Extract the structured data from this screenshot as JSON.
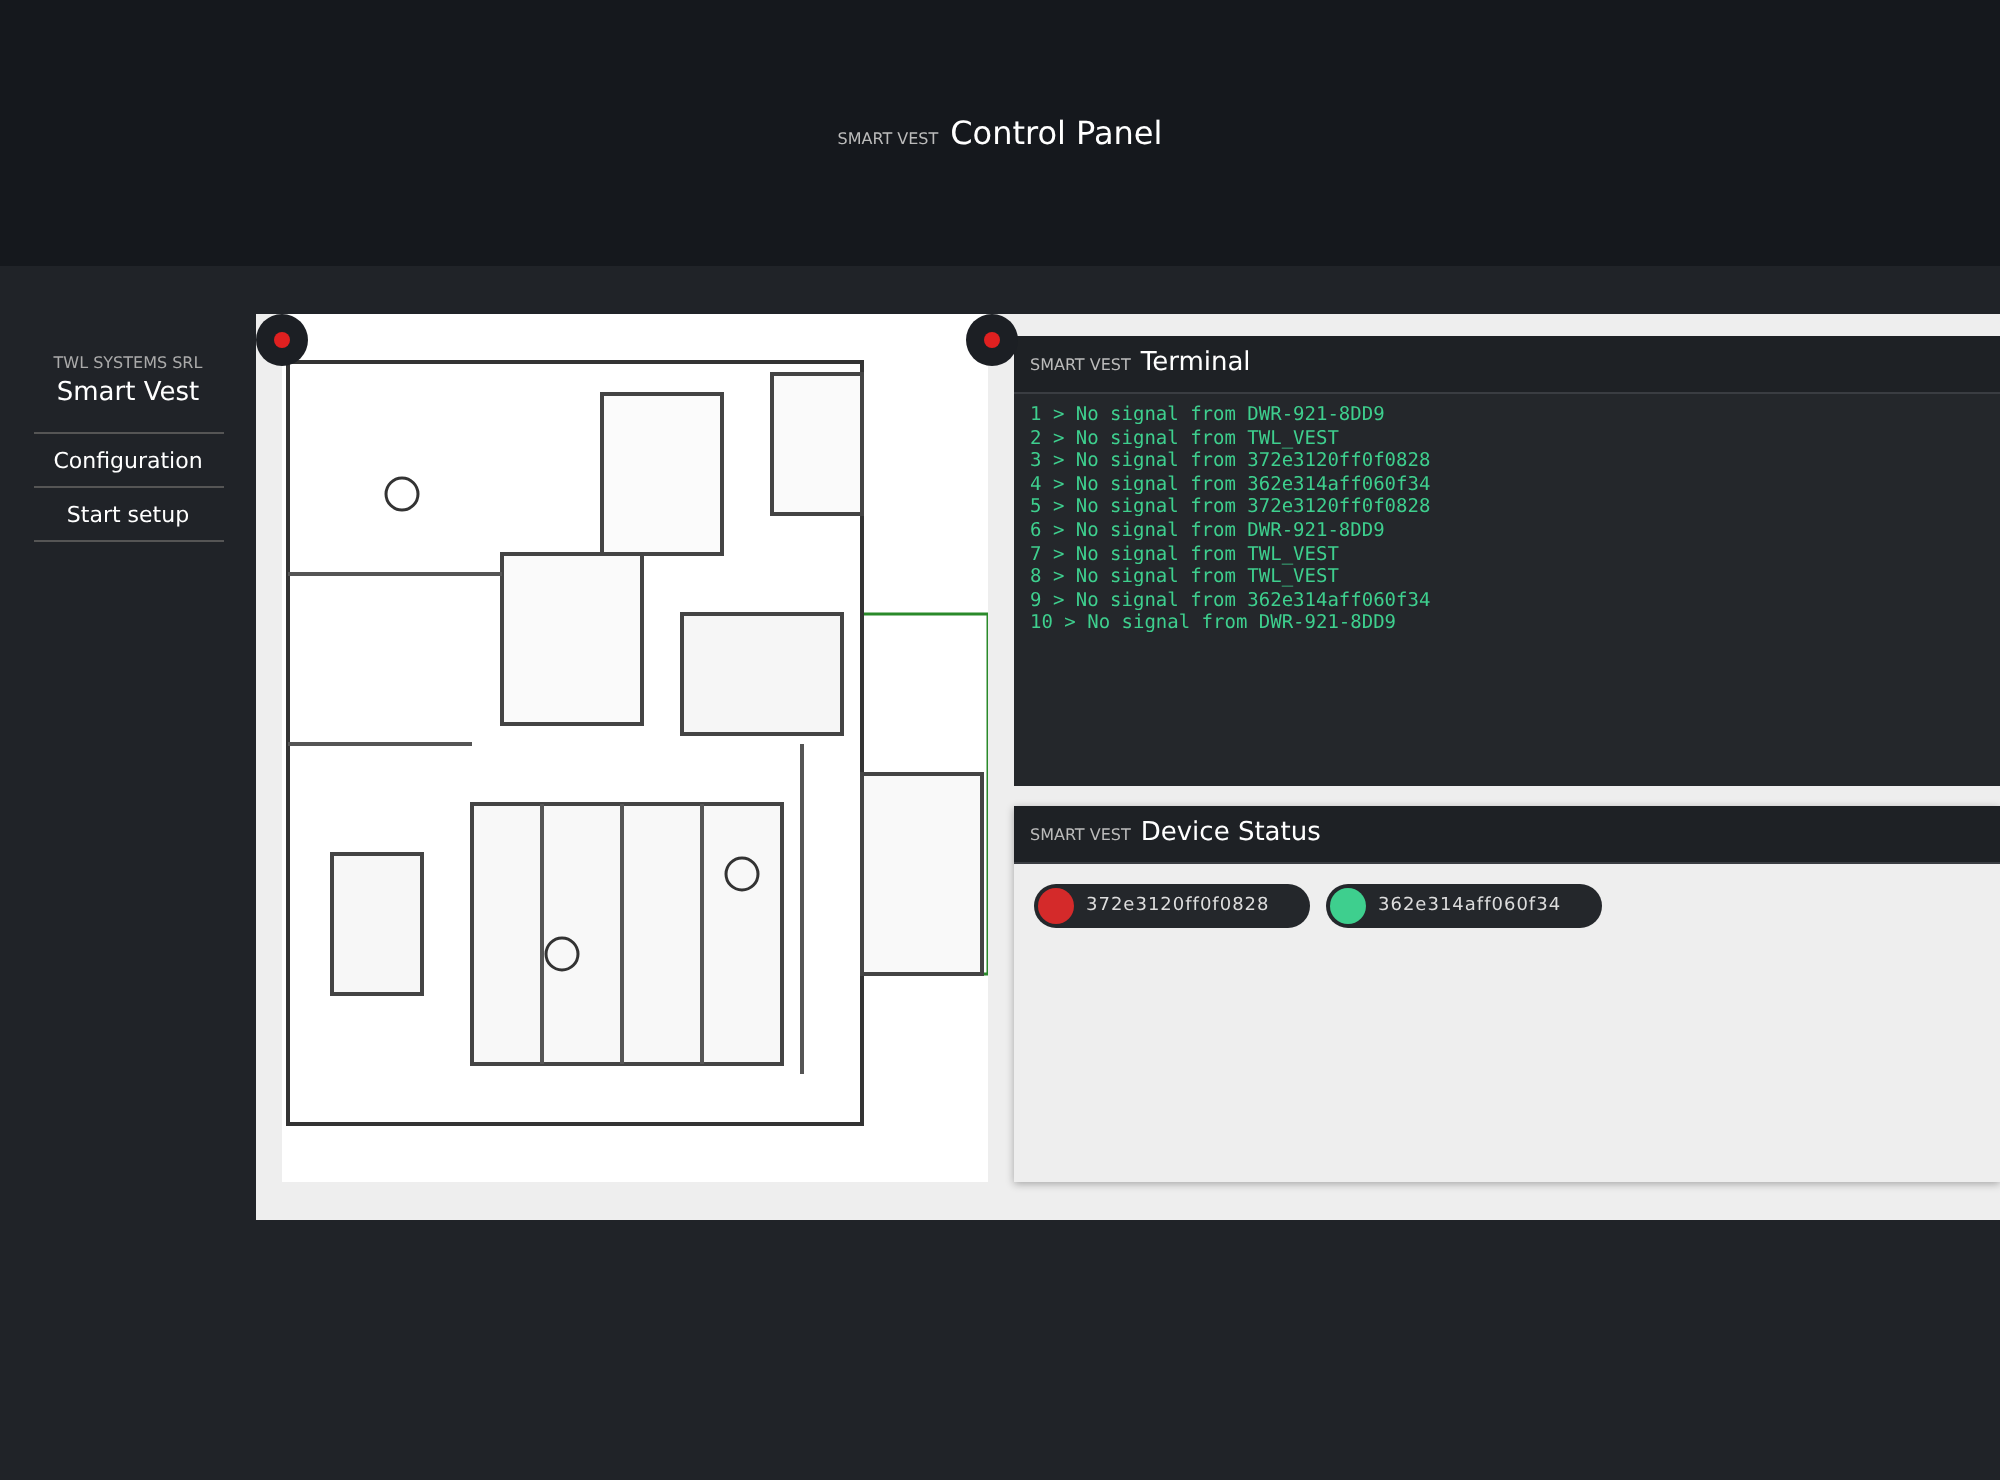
{
  "header": {
    "brand": "SMART VEST",
    "title": "Control Panel"
  },
  "sidebar": {
    "company": "TWL SYSTEMS SRL",
    "product": "Smart Vest",
    "items": [
      {
        "label": "Configuration"
      },
      {
        "label": "Start setup"
      }
    ]
  },
  "terminal": {
    "brand": "SMART VEST",
    "title": "Terminal",
    "lines": [
      "1 > No signal from DWR-921-8DD9",
      "2 > No signal from TWL_VEST",
      "3 > No signal from 372e3120ff0f0828",
      "4 > No signal from 362e314aff060f34",
      "5 > No signal from 372e3120ff0f0828",
      "6 > No signal from DWR-921-8DD9",
      "7 > No signal from TWL_VEST",
      "8 > No signal from TWL_VEST",
      "9 > No signal from 362e314aff060f34",
      "10 > No signal from DWR-921-8DD9"
    ]
  },
  "device_status": {
    "brand": "SMART VEST",
    "title": "Device Status",
    "devices": [
      {
        "id": "372e3120ff0f0828",
        "color": "#d42a2a"
      },
      {
        "id": "362e314aff060f34",
        "color": "#3ecf8e"
      }
    ]
  }
}
